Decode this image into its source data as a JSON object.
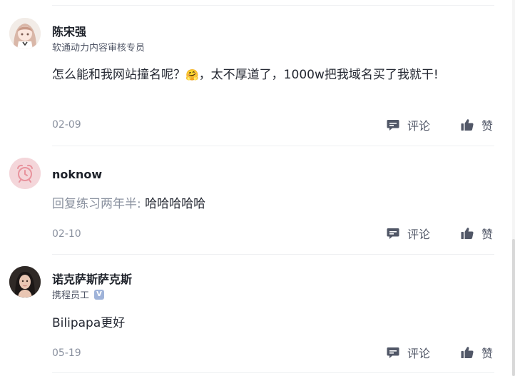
{
  "comments": [
    {
      "username": "陈宋强",
      "subtitle": "软通动力内容审核专员",
      "text_before_emoji": "怎么能和我网站撞名呢？",
      "emoji": "🤗",
      "text_after_emoji": "，太不厚道了，1000w把我域名买了我就干!",
      "date": "02-09",
      "reply_label": "评论",
      "like_label": "赞"
    },
    {
      "username": "noknow",
      "reply_prefix": "回复练习两年半:",
      "text": " 哈哈哈哈哈",
      "date": "02-10",
      "reply_label": "评论",
      "like_label": "赞"
    },
    {
      "username": "诺克萨斯萨克斯",
      "subtitle": "携程员工",
      "verified_mark": "V",
      "text": "Bilipapa更好",
      "date": "05-19",
      "reply_label": "评论",
      "like_label": "赞"
    }
  ],
  "colors": {
    "username": "#1d2129",
    "meta": "#8a919f",
    "action": "#515767",
    "divider": "#eef0f2",
    "avatar_bg_clock": "#f4d6da"
  },
  "icons": {
    "reply": "comment-bubble-icon",
    "like": "thumbs-up-icon",
    "avatar2": "alarm-clock-icon",
    "verified": "verified-badge-icon"
  }
}
